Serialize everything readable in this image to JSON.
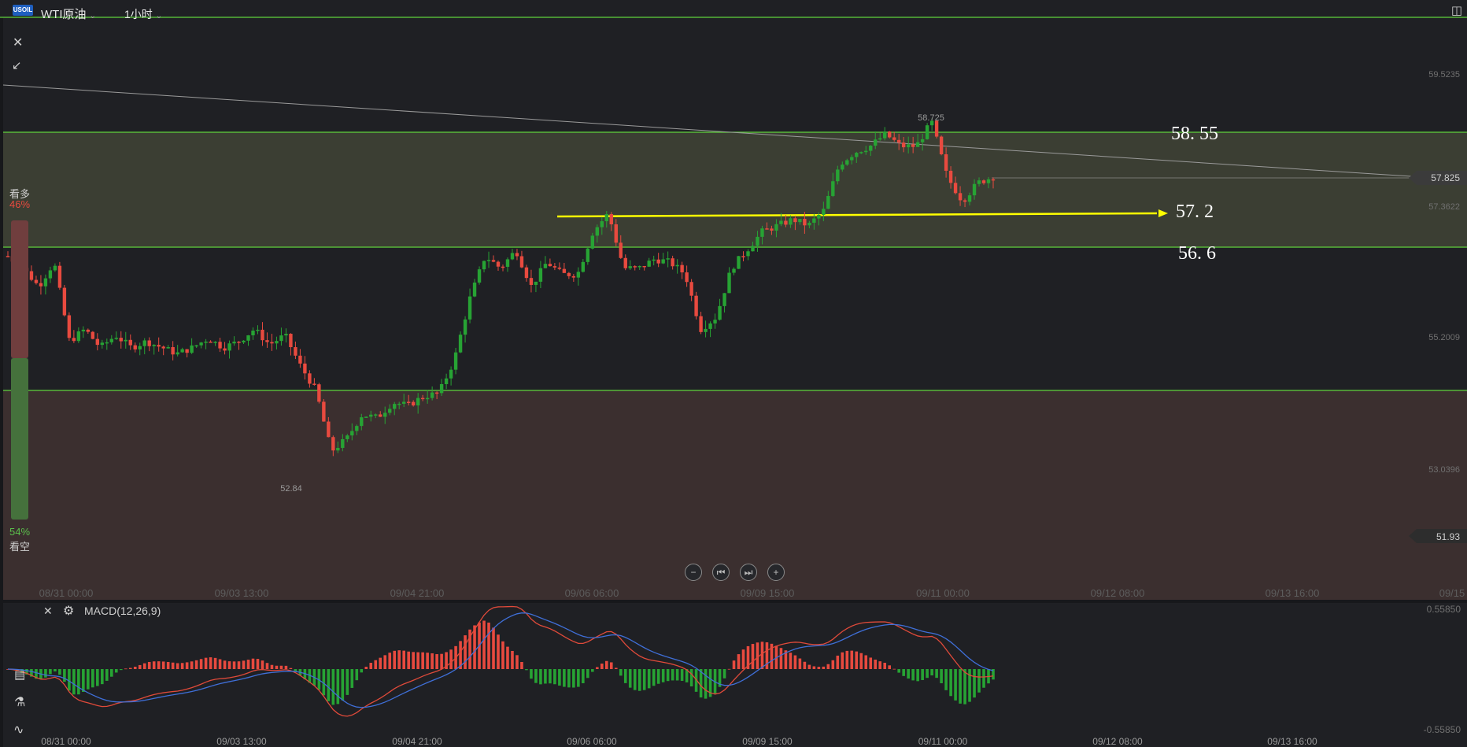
{
  "header": {
    "logo_text": "USOIL",
    "symbol": "WTI原油",
    "timeframe": "1小时"
  },
  "sentiment": {
    "bull_label": "看多",
    "bull_pct": "46%",
    "bear_label": "看空",
    "bear_pct": "54%"
  },
  "macd": {
    "label": "MACD(12,26,9)",
    "axis_top": "0.55850",
    "axis_bottom": "-0.55850"
  },
  "colors": {
    "up": "#27a334",
    "down": "#e84a3f",
    "macd_line": "#e04a3a",
    "signal_line": "#3f6fd8",
    "level_line": "#5fd23c",
    "arrow": "#ffff00"
  },
  "chart_data": {
    "type": "candlestick",
    "instrument": "WTI原油",
    "interval": "1小时",
    "y_ticks": [
      "59.5235",
      "57.3622",
      "55.2009",
      "53.0396"
    ],
    "price_tags": [
      "57.825",
      "51.93"
    ],
    "last_price": 57.825,
    "x_ticks": [
      "08/31 00:00",
      "09/03 13:00",
      "09/04 21:00",
      "09/06 06:00",
      "09/09 15:00",
      "09/11 00:00",
      "09/12 08:00",
      "09/13 16:00",
      "09/15"
    ],
    "annotations": {
      "high_label": "58.725",
      "low_label": "52.84",
      "levels": [
        {
          "label": "58. 55",
          "value": 58.55
        },
        {
          "label": "57. 2",
          "value": 57.2
        },
        {
          "label": "56. 6",
          "value": 56.6
        }
      ]
    },
    "series": [
      {
        "name": "price_path",
        "values": [
          56.5,
          56.3,
          56.0,
          56.4,
          55.1,
          55.3,
          55.0,
          55.2,
          55.0,
          55.1,
          55.0,
          54.9,
          55.0,
          55.15,
          55.0,
          55.1,
          55.3,
          55.05,
          55.2,
          54.7,
          54.3,
          53.3,
          53.5,
          53.9,
          53.85,
          54.1,
          54.05,
          54.2,
          54.25,
          54.8,
          55.8,
          56.5,
          56.3,
          56.6,
          56.0,
          56.4,
          56.2,
          56.2,
          56.9,
          57.2,
          56.3,
          56.3,
          56.45,
          56.4,
          56.2,
          55.3,
          55.5,
          56.3,
          56.6,
          56.9,
          57.0,
          57.1,
          57.0,
          57.25,
          58.0,
          58.2,
          58.3,
          58.5,
          58.3,
          58.3,
          58.7,
          57.8,
          57.4,
          57.7,
          57.8
        ]
      }
    ]
  }
}
